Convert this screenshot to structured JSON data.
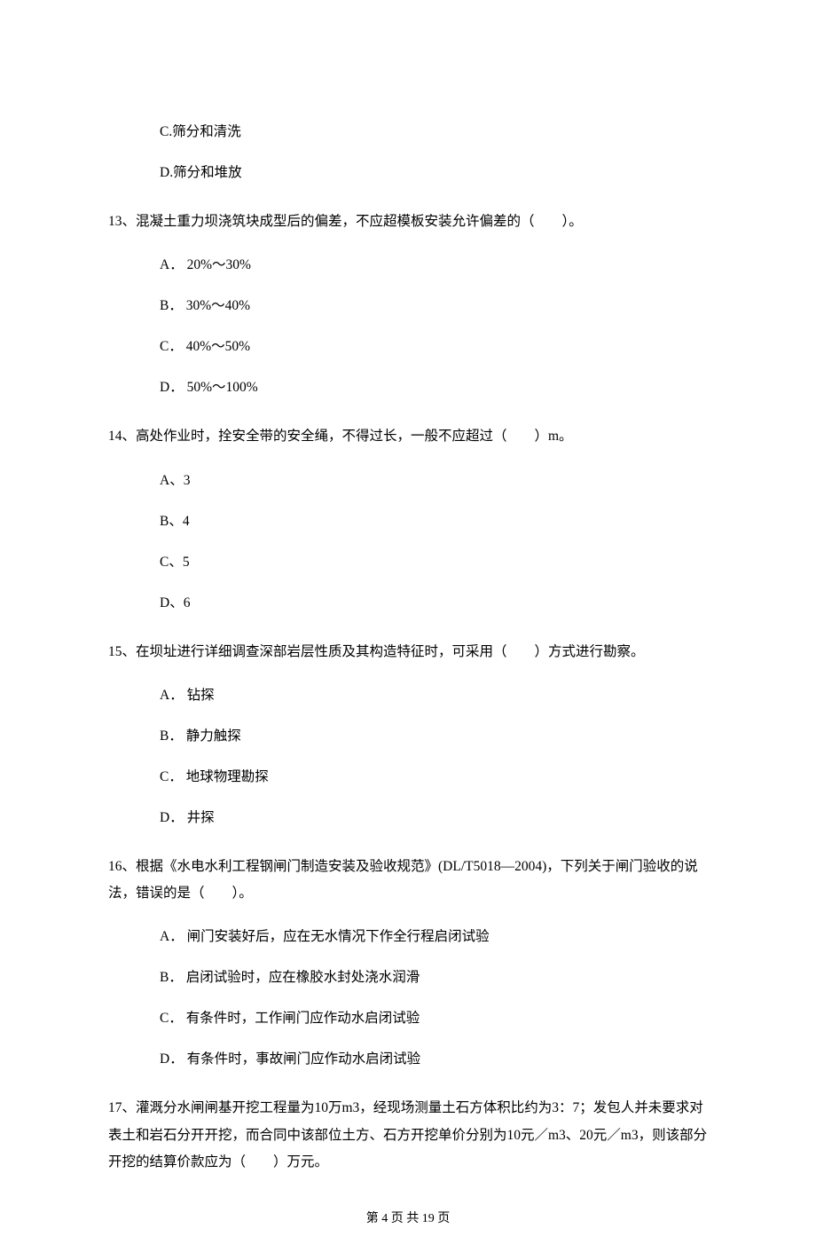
{
  "q12_options": {
    "c": "C.筛分和清洗",
    "d": "D.筛分和堆放"
  },
  "q13": {
    "stem": "13、混凝土重力坝浇筑块成型后的偏差，不应超模板安装允许偏差的（　　）。",
    "a": "A． 20%～30%",
    "b": "B． 30%～40%",
    "c": "C． 40%～50%",
    "d": "D． 50%～100%"
  },
  "q14": {
    "stem": "14、高处作业时，拴安全带的安全绳，不得过长，一般不应超过（　　）m。",
    "a": "A、3",
    "b": "B、4",
    "c": "C、5",
    "d": "D、6"
  },
  "q15": {
    "stem": "15、在坝址进行详细调查深部岩层性质及其构造特征时，可采用（　　）方式进行勘察。",
    "a": "A． 钻探",
    "b": "B． 静力触探",
    "c": "C． 地球物理勘探",
    "d": "D． 井探"
  },
  "q16": {
    "stem": "16、根据《水电水利工程钢闸门制造安装及验收规范》(DL/T5018—2004)，下列关于闸门验收的说法，错误的是（　　）。",
    "a": "A． 闸门安装好后，应在无水情况下作全行程启闭试验",
    "b": "B． 启闭试验时，应在橡胶水封处浇水润滑",
    "c": "C． 有条件时，工作闸门应作动水启闭试验",
    "d": "D． 有条件时，事故闸门应作动水启闭试验"
  },
  "q17": {
    "stem": "17、灌溉分水闸闸基开挖工程量为10万m3，经现场测量土石方体积比约为3：7；发包人并未要求对表土和岩石分开开挖，而合同中该部位土方、石方开挖单价分别为10元／m3、20元／m3，则该部分开挖的结算价款应为（　　）万元。"
  },
  "footer": "第 4 页 共 19 页"
}
